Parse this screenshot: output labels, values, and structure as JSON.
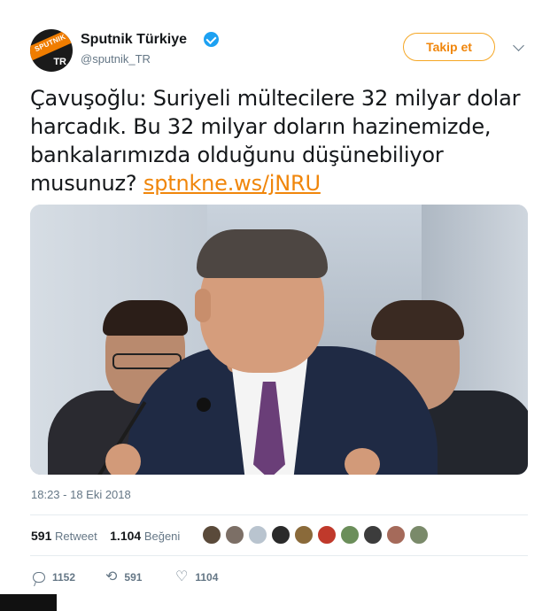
{
  "account": {
    "name": "Sputnik Türkiye",
    "handle": "@sputnik_TR",
    "avatar_text": "SPUTNIK",
    "avatar_badge": "TR",
    "verified": true
  },
  "header": {
    "follow_label": "Takip et",
    "menu_icon": "chevron-down-icon"
  },
  "tweet": {
    "text": "Çavuşoğlu: Suriyeli mültecilere 32 milyar dolar harcadık. Bu 32 milyar doların hazinemizde, bankalarımızda olduğunu düşünebiliyor musunuz?",
    "link": "sptnkne.ws/jNRU",
    "timestamp": "18:23 - 18 Eki 2018"
  },
  "stats": {
    "retweets": "591",
    "retweets_label": "Retweet",
    "likes": "1.104",
    "likes_label": "Beğeni"
  },
  "actions": {
    "reply_count": "1152",
    "retweet_count": "591",
    "like_count": "1104"
  },
  "colors": {
    "accent": "#f0860b",
    "muted": "#657786",
    "text": "#14171a",
    "verified": "#1da1f2"
  },
  "likers": [
    "#5a4a3a",
    "#7c6f66",
    "#b9c4cf",
    "#2a2a2a",
    "#8a6a3a",
    "#c0392b",
    "#6b8e5a",
    "#3c3c3c",
    "#a56a5a",
    "#7a8a6a"
  ]
}
